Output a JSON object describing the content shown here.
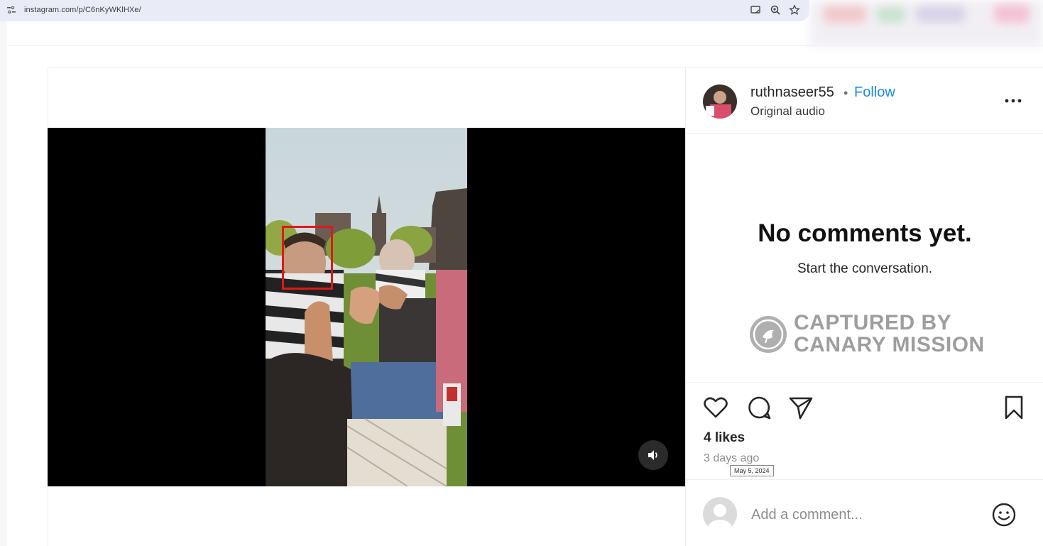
{
  "browser": {
    "url": "instagram.com/p/C6nKyWKlHXe/",
    "icons": [
      "site-info-icon",
      "cast-icon",
      "zoom-icon",
      "bookmark-star-icon"
    ]
  },
  "post": {
    "username": "ruthnaseer55",
    "separator": "•",
    "follow_label": "Follow",
    "audio_label": "Original audio",
    "comments_empty_title": "No comments yet.",
    "comments_empty_subtitle": "Start the conversation.",
    "watermark": {
      "line1": "CAPTURED BY",
      "line2": "CANARY MISSION"
    },
    "likes": "4 likes",
    "time_ago": "3 days ago",
    "date_tooltip": "May 5, 2024",
    "comment_placeholder": "Add a comment..."
  },
  "colors": {
    "accent": "#1a8ded",
    "highlight_box": "#e01818"
  }
}
